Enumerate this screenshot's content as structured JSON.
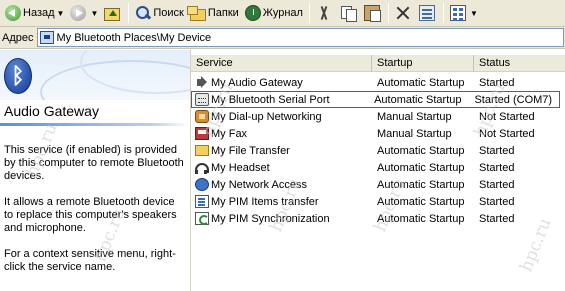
{
  "toolbar": {
    "back_label": "Назад",
    "search_label": "Поиск",
    "folders_label": "Папки",
    "history_label": "Журнал"
  },
  "address": {
    "label": "Адрес",
    "value": "My Bluetooth Places\\My Device"
  },
  "left_pane": {
    "title": "Audio Gateway",
    "paragraphs": [
      "This service (if enabled) is provided by this computer to remote Bluetooth devices.",
      "It allows a remote Bluetooth device to replace this computer's speakers and microphone.",
      "For a context sensitive menu, right-click the service name."
    ]
  },
  "list": {
    "columns": [
      "Service",
      "Startup",
      "Status"
    ],
    "rows": [
      {
        "service": "My Audio Gateway",
        "startup": "Automatic Startup",
        "status": "Started",
        "icon": "speaker-icon"
      },
      {
        "service": "My Bluetooth Serial Port",
        "startup": "Automatic Startup",
        "status": "Started (COM7)",
        "icon": "serial-port-icon"
      },
      {
        "service": "My Dial-up Networking",
        "startup": "Manual Startup",
        "status": "Not Started",
        "icon": "phone-icon"
      },
      {
        "service": "My Fax",
        "startup": "Manual Startup",
        "status": "Not Started",
        "icon": "fax-icon"
      },
      {
        "service": "My File Transfer",
        "startup": "Automatic Startup",
        "status": "Started",
        "icon": "folder-icon"
      },
      {
        "service": "My Headset",
        "startup": "Automatic Startup",
        "status": "Started",
        "icon": "headset-icon"
      },
      {
        "service": "My Network Access",
        "startup": "Automatic Startup",
        "status": "Started",
        "icon": "network-icon"
      },
      {
        "service": "My PIM Items transfer",
        "startup": "Automatic Startup",
        "status": "Started",
        "icon": "pim-icon"
      },
      {
        "service": "My PIM Synchronization",
        "startup": "Automatic Startup",
        "status": "Started",
        "icon": "sync-icon"
      }
    ]
  },
  "watermark_text": "hpc.ru",
  "colors": {
    "highlight_border": "#c63030",
    "task_pane_rule": "#5f8fd0"
  }
}
